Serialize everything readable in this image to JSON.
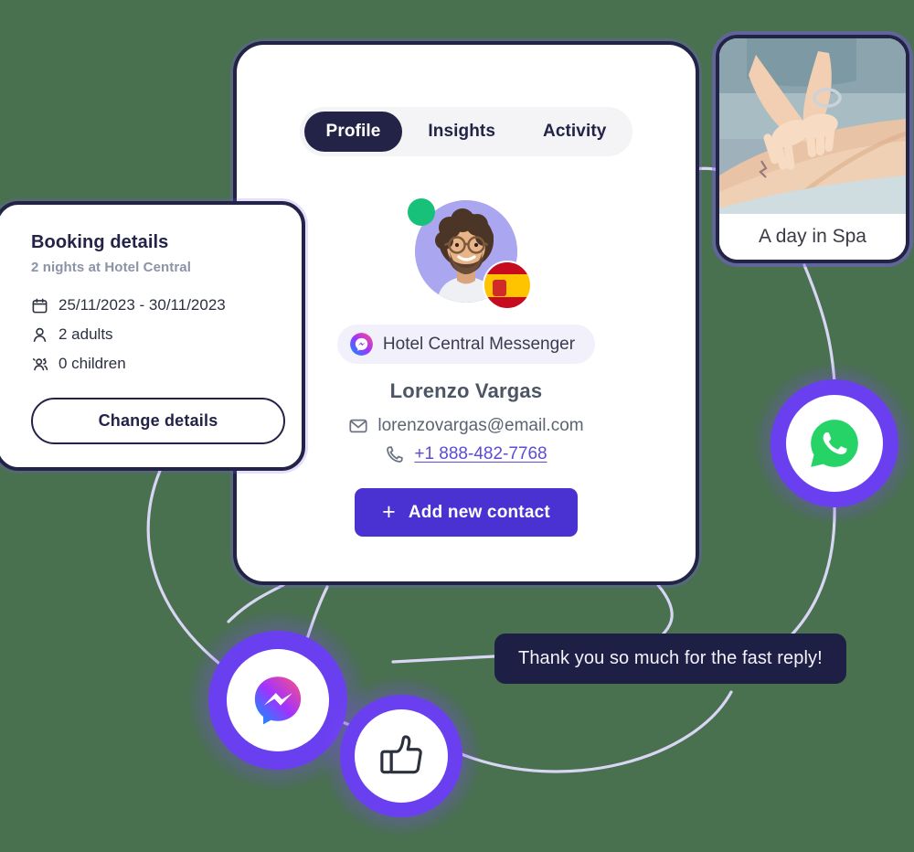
{
  "page": {
    "background_color": "#49704f",
    "accent_color": "#4a31d2",
    "dark_color": "#232348",
    "line_color": "#d9d6f5"
  },
  "profile_card": {
    "tabs": [
      {
        "label": "Profile",
        "active": true
      },
      {
        "label": "Insights",
        "active": false
      },
      {
        "label": "Activity",
        "active": false
      }
    ],
    "avatar": {
      "status": "online",
      "status_color": "#18c17a",
      "flag": "spain-flag-icon",
      "background_color": "#aaa6f0"
    },
    "channel_badge": {
      "icon": "messenger-icon",
      "label": "Hotel Central Messenger"
    },
    "name": "Lorenzo Vargas",
    "email": "lorenzovargas@email.com",
    "email_icon": "envelope-icon",
    "phone": "+1 888-482-7768",
    "phone_icon": "phone-icon",
    "add_contact_button": {
      "label": "Add new contact",
      "icon": "plus-icon"
    }
  },
  "booking_card": {
    "title": "Booking details",
    "subtitle": "2 nights at Hotel Central",
    "items": [
      {
        "icon": "calendar-icon",
        "text": "25/11/2023 - 30/11/2023"
      },
      {
        "icon": "person-icon",
        "text": "2 adults"
      },
      {
        "icon": "group-icon",
        "text": "0 children"
      }
    ],
    "change_button_label": "Change details"
  },
  "spa_card": {
    "caption": "A day in Spa",
    "image_alt": "spa-massage-photo"
  },
  "chat_bubble": {
    "message": "Thank you so much for the fast reply!"
  },
  "orbs": [
    {
      "name": "whatsapp",
      "icon": "whatsapp-icon",
      "color": "#25d366"
    },
    {
      "name": "messenger",
      "icon": "messenger-icon",
      "color": "#0084ff"
    },
    {
      "name": "like",
      "icon": "thumbs-up-icon",
      "color": "#2c3140"
    }
  ]
}
